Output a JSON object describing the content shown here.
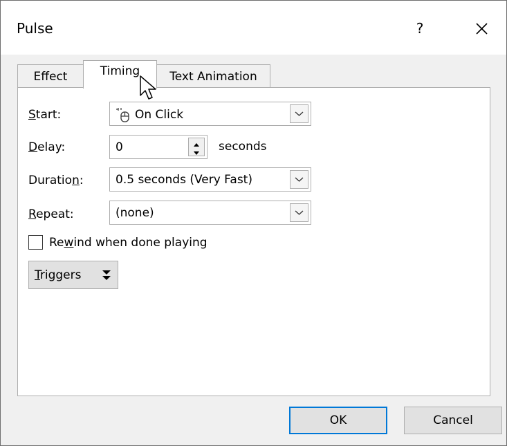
{
  "window": {
    "title": "Pulse",
    "help_label": "?",
    "close_icon": "close-icon"
  },
  "tabs": [
    {
      "label": "Effect",
      "active": false
    },
    {
      "label": "Timing",
      "active": true
    },
    {
      "label": "Text Animation",
      "active": false
    }
  ],
  "timing": {
    "start": {
      "label_mnemonic": "S",
      "label_rest": "tart:",
      "value": "On Click",
      "icon": "mouse-click-icon"
    },
    "delay": {
      "label_mnemonic": "D",
      "label_rest": "elay:",
      "value": "0",
      "unit": "seconds"
    },
    "duration": {
      "label_before": "Duratio",
      "label_mnemonic": "n",
      "label_after": ":",
      "value": "0.5 seconds (Very Fast)"
    },
    "repeat": {
      "label_mnemonic": "R",
      "label_rest": "epeat:",
      "value": "(none)"
    },
    "rewind": {
      "label_before": "Re",
      "label_mnemonic": "w",
      "label_after": "ind when done playing",
      "checked": false
    },
    "triggers": {
      "label_mnemonic": "T",
      "label_rest": "riggers",
      "icon": "double-chevron-down-icon"
    }
  },
  "footer": {
    "ok_label": "OK",
    "cancel_label": "Cancel"
  },
  "colors": {
    "accent": "#0078d7",
    "border": "#adadad",
    "background": "#f0f0f0"
  }
}
